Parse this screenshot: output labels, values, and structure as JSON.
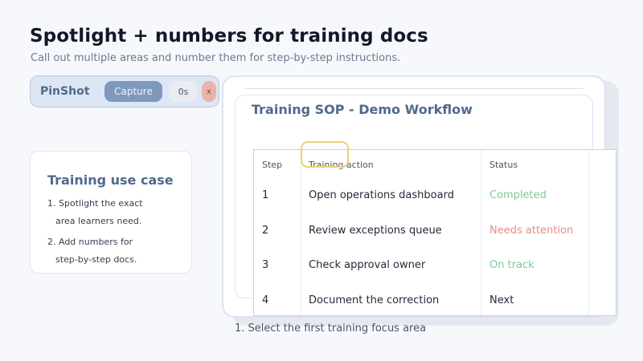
{
  "header": {
    "title": "Spotlight + numbers for training docs",
    "subtitle": "Call out multiple areas and number them for step-by-step instructions."
  },
  "toolbar": {
    "app_name": "PinShot",
    "capture_label": "Capture",
    "timer_value": "0s",
    "close_label": "x"
  },
  "usecase": {
    "title": "Training use case",
    "lines": [
      "1. Spotlight the exact",
      "area learners need.",
      "2. Add numbers for",
      "step-by-step docs."
    ]
  },
  "preview": {
    "window_title": "Training SOP - Demo Workflow",
    "table": {
      "headers": [
        "Step",
        "Training action",
        "Status"
      ],
      "rows": [
        {
          "step": "1",
          "action": "Open operations dashboard",
          "status": "Completed"
        },
        {
          "step": "2",
          "action": "Review exceptions queue",
          "status": "Needs attention"
        },
        {
          "step": "3",
          "action": "Check approval owner",
          "status": "On track"
        },
        {
          "step": "4",
          "action": "Document the correction",
          "status": "Next"
        }
      ]
    },
    "focus_caption": "1. Select the first training focus area"
  },
  "colors": {
    "accent": "#4f6a8c",
    "capture_button": "#7f98bd",
    "focus_marker": "#f2cf72",
    "status_completed": "#7cc99a",
    "status_attention": "#e08f8a"
  }
}
